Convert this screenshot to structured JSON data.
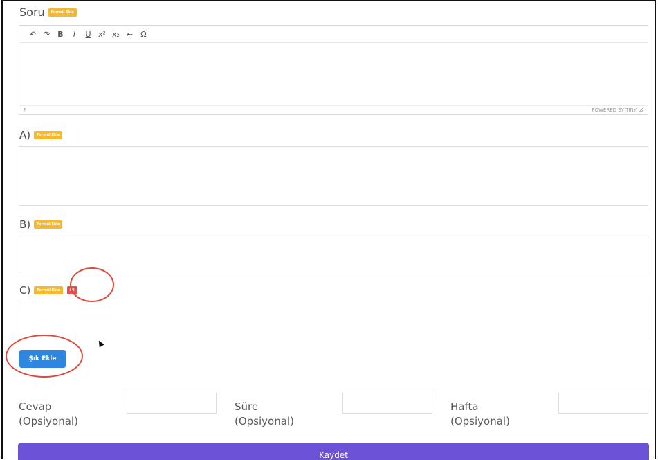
{
  "question": {
    "label": "Soru",
    "formula_badge": "Formül Ekle",
    "toolbar": [
      "↶",
      "↷",
      "B",
      "I",
      "U",
      "x²",
      "x₂",
      "⇤",
      "Ω"
    ],
    "status_path": "P",
    "powered_by": "POWERED BY TINY"
  },
  "options": [
    {
      "label": "A)",
      "formula_badge": "Formül Ekle"
    },
    {
      "label": "B)",
      "formula_badge": "Formül Ekle"
    },
    {
      "label": "C)",
      "formula_badge": "Formül Ekle",
      "delete_badge": "Sil"
    }
  ],
  "add_option_button": "Şık Ekle",
  "fields": [
    {
      "label": "Cevap",
      "sub": "(Opsiyonal)"
    },
    {
      "label": "Süre",
      "sub": "(Opsiyonal)"
    },
    {
      "label": "Hafta",
      "sub": "(Opsiyonal)"
    }
  ],
  "save_button": "Kaydet",
  "colors": {
    "badge": "#f5b82e",
    "delete": "#e05252",
    "add_button": "#2e86de",
    "save_button": "#6b52d6",
    "highlight_circle": "#e0483a"
  }
}
